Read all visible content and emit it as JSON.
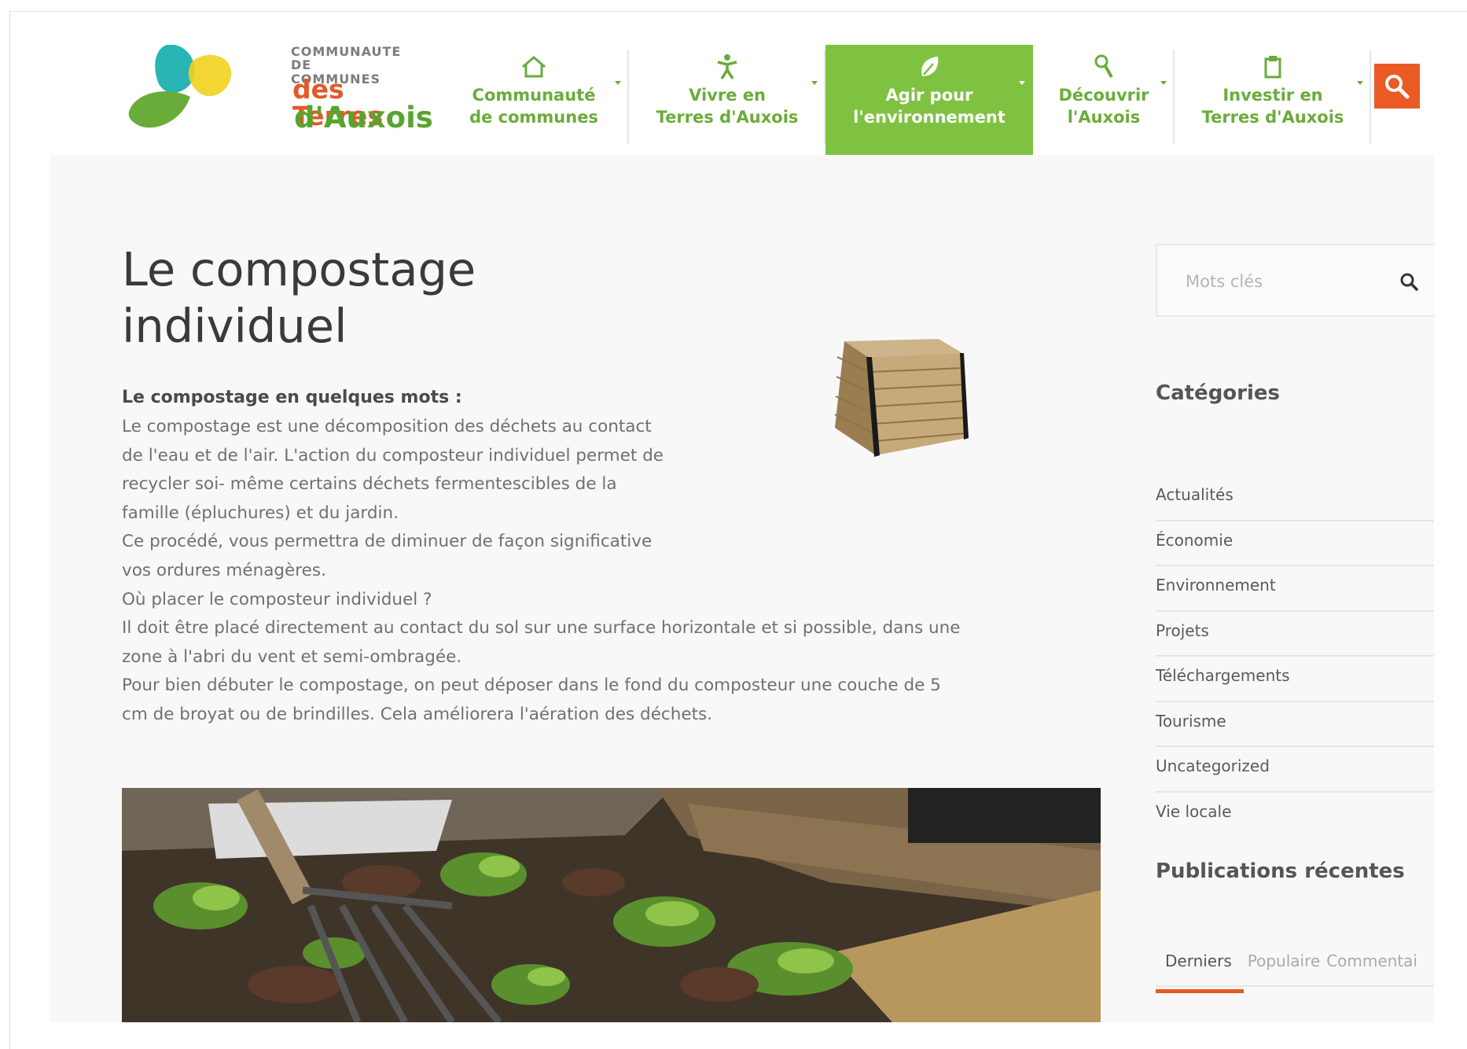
{
  "brand": {
    "line1": "COMMUNAUTE",
    "line2": "DE COMMUNES",
    "name_main": "des Terres",
    "name_sub": "d'Auxois",
    "colors": {
      "orange": "#ea5a24",
      "green": "#7fc241",
      "green_dark": "#57a52d",
      "teal": "#2ab5b5",
      "yellow": "#f0d21e"
    }
  },
  "nav": {
    "items": [
      {
        "line1": "Communauté",
        "line2": "de communes",
        "icon": "home-icon",
        "active": false
      },
      {
        "line1": "Vivre en",
        "line2": "Terres d'Auxois",
        "icon": "person-icon",
        "active": false
      },
      {
        "line1": "Agir pour",
        "line2": "l'environnement",
        "icon": "leaf-icon",
        "active": true
      },
      {
        "line1": "Découvrir",
        "line2": "l'Auxois",
        "icon": "magnifier-icon",
        "active": false
      },
      {
        "line1": "Investir en",
        "line2": "Terres d'Auxois",
        "icon": "clipboard-icon",
        "active": false
      }
    ]
  },
  "article": {
    "title_line1": "Le compostage",
    "title_line2": "individuel",
    "intro_heading": "Le compostage en quelques mots :",
    "para1": "Le compostage est une décomposition des déchets au contact de l'eau et de l'air. L'action du composteur individuel permet de recycler soi- même certains déchets fermentescibles de la famille (épluchures) et du jardin.",
    "para2": "Ce procédé, vous permettra de diminuer de façon significative vos ordures ménagères.",
    "para3": "Où placer le composteur individuel ?",
    "para4_line1": "Il doit être placé directement au contact du sol sur une surface horizontale et si possible, dans une",
    "para4_line2": "zone à l'abri du vent et semi-ombragée.",
    "para5_line1": "Pour bien débuter le compostage, on peut déposer dans le fond du composteur une couche de 5",
    "para5_line2": "cm de broyat ou de brindilles. Cela améliorera l'aération des déchets."
  },
  "sidebar": {
    "search_placeholder": "Mots clés",
    "categories_title": "Catégories",
    "categories": [
      "Actualités",
      "Économie",
      "Environnement",
      "Projets",
      "Téléchargements",
      "Tourisme",
      "Uncategorized",
      "Vie locale"
    ],
    "recent_title": "Publications récentes",
    "tabs": [
      "Derniers",
      "Populaire",
      "Commentai"
    ]
  }
}
